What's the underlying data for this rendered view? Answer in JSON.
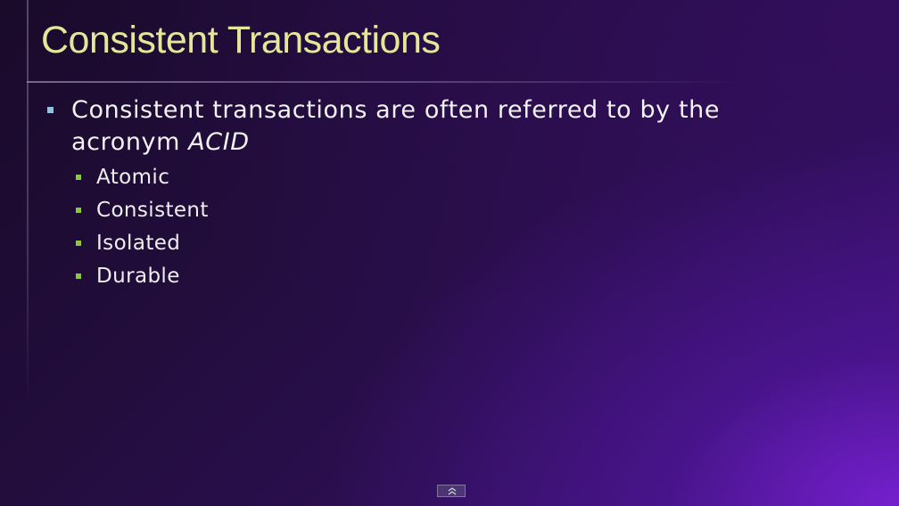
{
  "slide": {
    "title": "Consistent Transactions",
    "bullet": {
      "line1": "Consistent transactions are often referred to by the",
      "line2_prefix": "acronym ",
      "line2_emphasis": "ACID"
    },
    "sub_bullets": [
      {
        "label": "Atomic"
      },
      {
        "label": "Consistent"
      },
      {
        "label": "Isolated"
      },
      {
        "label": "Durable"
      }
    ]
  },
  "colors": {
    "title": "#e4e79a",
    "text": "#f2f2f2",
    "bullet_level1": "#8fc4e0",
    "bullet_level2": "#8dc63f",
    "background_dark": "#1a0a2a",
    "background_accent": "#7820d2"
  },
  "controls": {
    "expand_icon": "double-chevron-up-icon"
  }
}
